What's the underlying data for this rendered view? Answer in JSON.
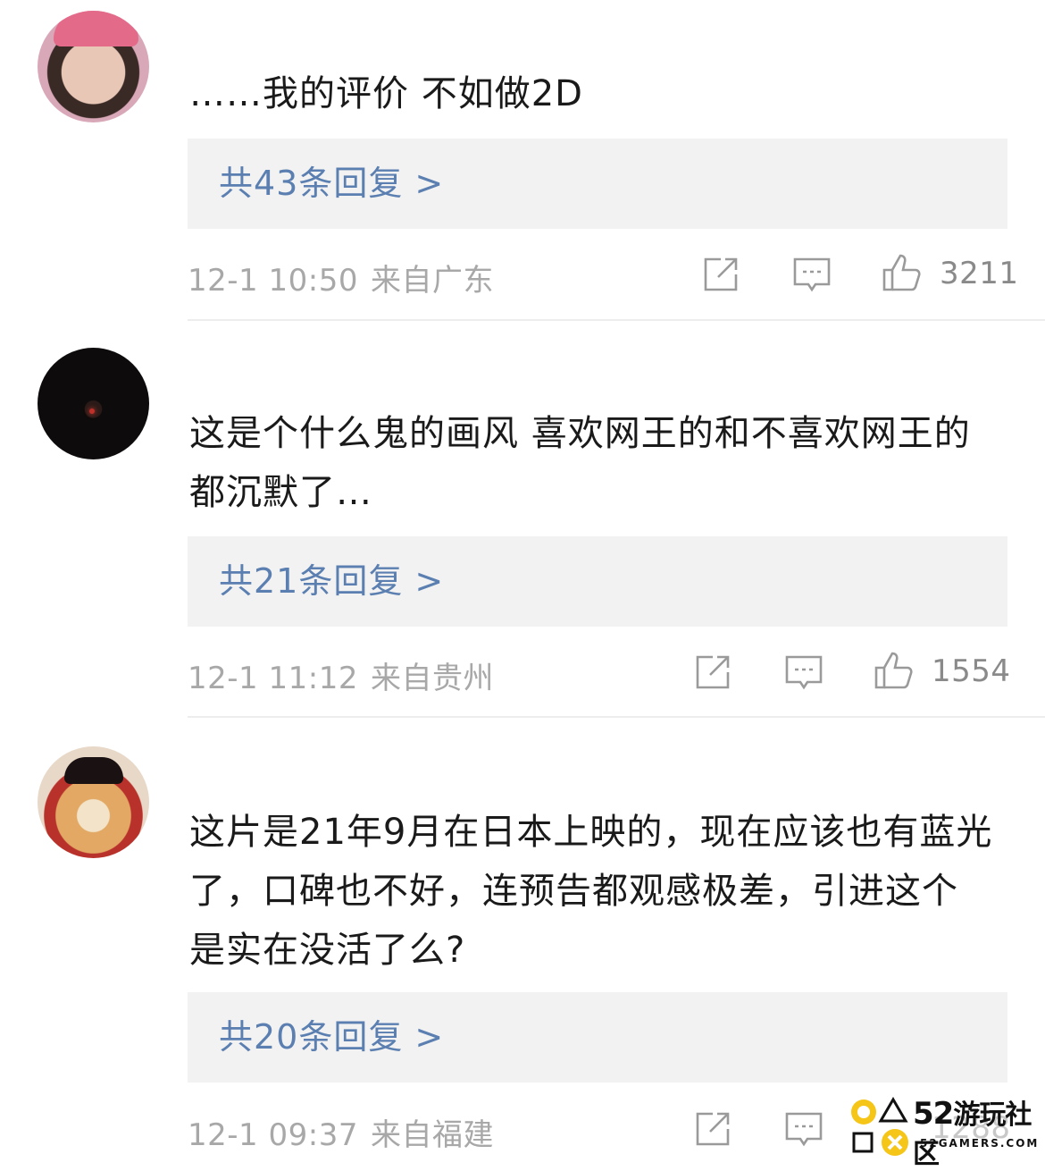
{
  "comments": [
    {
      "text": "……我的评价 不如做2D",
      "replies": "共43条回复 >",
      "time": "12-1 10:50",
      "location": "来自广东",
      "likes": "3211"
    },
    {
      "text": "这是个什么鬼的画风 喜欢网王的和不喜欢网王的都沉默了…",
      "replies": "共21条回复 >",
      "time": "12-1 11:12",
      "location": "来自贵州",
      "likes": "1554"
    },
    {
      "text": "这片是21年9月在日本上映的，现在应该也有蓝光了，口碑也不好，连预告都观感极差，引进这个是实在没活了么?",
      "replies": "共20条回复 >",
      "time": "12-1 09:37",
      "location": "来自福建",
      "likes": "1288"
    }
  ],
  "watermark": {
    "number": "52",
    "title": "游玩社区",
    "subtitle": "52GAMERS.COM"
  },
  "icons": {
    "share": "share-icon",
    "comment": "comment-icon",
    "like": "thumbs-up-icon"
  },
  "colors": {
    "reply_link": "#5a7fb0",
    "meta_text": "#a8a8a8",
    "reply_bg": "#f2f2f2"
  }
}
